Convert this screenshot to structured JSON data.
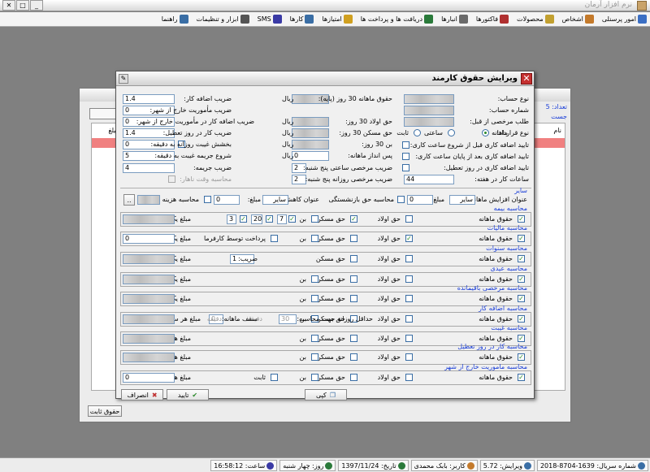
{
  "app_title": "نرم افزار آرمان",
  "menu": [
    {
      "label": "امور پرسنلی",
      "icon": "people-icon",
      "color": "#3b6fc4"
    },
    {
      "label": "اشخاص",
      "icon": "person-icon",
      "color": "#c47a2b"
    },
    {
      "label": "محصولات",
      "icon": "product-icon",
      "color": "#c2a030"
    },
    {
      "label": "فاکتورها",
      "icon": "invoice-icon",
      "color": "#b03030"
    },
    {
      "label": "انبارها",
      "icon": "warehouse-icon",
      "color": "#6a6a6a"
    },
    {
      "label": "دریافت ها و پرداخت ها",
      "icon": "payment-icon",
      "color": "#2a7a3a"
    },
    {
      "label": "امتیازها",
      "icon": "star-icon",
      "color": "#d0a020"
    },
    {
      "label": "کارها",
      "icon": "task-icon",
      "color": "#3a6ea5"
    },
    {
      "label": "SMS",
      "icon": "sms-icon",
      "color": "#3a3aa5"
    },
    {
      "label": "ابزار و تنظیمات",
      "icon": "tools-icon",
      "color": "#555555"
    },
    {
      "label": "راهنما",
      "icon": "help-icon",
      "color": "#3a6ea5"
    }
  ],
  "background_window": {
    "count_label": "تعداد: 5",
    "search_label": "جست",
    "name_col": "نام",
    "amount_col": "مبلغ",
    "fixed_btn": "حقوق ثابت"
  },
  "dialog": {
    "title": "ویرایش حقوق کارمند",
    "right": {
      "contract_type_label": "نوع حساب:",
      "account_no_label": "شماره حساب:",
      "prev_leave_label": "طلب مرخصی از قبل:",
      "contract_kind_label": "نوع قرارداد:",
      "radio_monthly": "ماهانه",
      "radio_hourly": "ساعتی",
      "radio_fixed": "ثابت",
      "confirm_before_start": "تایید اضافه کاری قبل از شروع ساعت کاری:",
      "confirm_after_end": "تایید اضافه کاری بعد از پایان ساعت کاری:",
      "confirm_holiday": "تایید اضافه کاری در روز تعطیل:",
      "work_hours_label": "ساعات کار در هفته:",
      "work_hours_value": "44"
    },
    "middle": {
      "base_salary_label": "حقوق ماهانه 30 روز (پایه):",
      "child_allow_label": "حق اولاد 30 روز:",
      "housing_label": "حق مسکن 30 روز:",
      "bon_label": "بن 30 روز:",
      "savings_label": "پس انداز ماهانه:",
      "savings_value": "0",
      "hourly_leave_coef_label": "ضریب مرخصی ساعتی پنج شنبه:",
      "hourly_leave_coef_value": "2",
      "daily_leave_coef_label": "ضریب مرخصی روزانه پنج شنبه:",
      "daily_leave_coef_value": "2",
      "currency": "ریال"
    },
    "left": {
      "overtime_coef_label": "ضریب اضافه کار:",
      "overtime_coef_value": "1.4",
      "mission_in_label": "ضریب مأموریت خارج از شهر:",
      "mission_in_value": "0",
      "mission_overtime_label": "ضریب اضافه کار در مأموریت خارج از شهر:",
      "mission_overtime_value": "0",
      "holiday_coef_label": "ضریب کار در روز تعطیل:",
      "holiday_coef_value": "1.4",
      "late_forgive_label": "بخشش غیبت روزانه به دقیقه:",
      "late_forgive_value": "0",
      "late_start_label": "شروع جریمه غیبت به دقیقه:",
      "late_start_value": "5",
      "penalty_coef_label": "ضریب جریمه:",
      "penalty_coef_value": "4",
      "free_time_label": "محاسبه وقت ناهار:"
    },
    "other": {
      "title": "سایر",
      "increase_label": "عنوان افزایش ماهانه:",
      "increase_select": "سایر",
      "amount_label": "مبلغ:",
      "amount_value": "0",
      "retire_label": "محاسبه حق بازنشستگی",
      "decrease_label": "عنوان کاهش ماهانه:",
      "decrease_select": "سایر",
      "decrease_amount_value": "0",
      "internal_label": "محاسبه هزینه داخلی",
      "dots_btn": ".."
    },
    "groups": [
      {
        "title": "محاسبه بیمه",
        "base": "حقوق ماهانه",
        "child": "حق اولاد",
        "housing": "حق مسکن",
        "bon": "بن",
        "v1": "7",
        "v2": "20",
        "v3": "3",
        "amount_label": "مبلغ یک ماه:"
      },
      {
        "title": "محاسبه مالیات",
        "base": "حقوق ماهانه",
        "child": "حق اولاد",
        "housing": "حق مسکن",
        "bon": "بن",
        "avg_label": "پرداخت توسط کارفرما",
        "amount_label": "مبلغ یک ماه:",
        "amount_value": "0"
      },
      {
        "title": "محاسبه سنوات",
        "base": "حقوق ماهانه",
        "child": "حق اولاد",
        "housing": "حق مسکن",
        "coef_label": "ضریب:",
        "coef_value": "1",
        "amount_label": "مبلغ یک سال:"
      },
      {
        "title": "محاسبه عیدی",
        "base": "حقوق ماهانه",
        "child": "حق اولاد",
        "housing": "حق مسکن",
        "bon": "بن",
        "amount_label": "مبلغ یک سال:"
      },
      {
        "title": "محاسبه مرخصی باقیمانده",
        "base": "حقوق ماهانه",
        "child": "حق اولاد",
        "housing": "حق مسکن",
        "bon": "بن",
        "amount_label": "مبلغ یک روز:"
      },
      {
        "title": "محاسبه اضافه کار",
        "base": "حقوق ماهانه",
        "child": "حق اولاد",
        "housing": "حق مسکن",
        "bon": "بن",
        "min_daily": "حداقل روزانه جهت محاسبه:",
        "min_value": "30",
        "minute": "دقیقه",
        "cap_label": "سقف ماهانه:",
        "cap_value": "0",
        "cap_unit": "دقیقه",
        "amount_label": "مبلغ هر ساعت:"
      },
      {
        "title": "محاسبه غیبت",
        "base": "حقوق ماهانه",
        "child": "حق اولاد",
        "housing": "حق مسکن",
        "bon": "بن",
        "amount_label": "مبلغ هر ساعت:"
      },
      {
        "title": "محاسبه کار در روز تعطیل",
        "base": "حقوق ماهانه",
        "child": "حق اولاد",
        "housing": "حق مسکن",
        "bon": "بن",
        "amount_label": "مبلغ هر ساعت:"
      },
      {
        "title": "محاسبه ماموریت خارج از شهر",
        "base": "حقوق ماهانه",
        "child": "حق اولاد",
        "housing": "حق مسکن",
        "bon": "بن",
        "fixed": "ثابت",
        "amount_label": "مبلغ هر ساعت:",
        "amount_value": "0"
      }
    ],
    "buttons": {
      "cancel": "انصراف",
      "ok": "تایید",
      "copy": "کپی"
    }
  },
  "status": {
    "serial": "شماره سریال: 1639-8704-2018",
    "version": "ویرایش: 5.72",
    "user": "کاربر: بابک محمدی",
    "date": "تاریخ: 1397/11/24",
    "day": "روز: چهار شنبه",
    "time": "ساعت: 16:58:12"
  }
}
